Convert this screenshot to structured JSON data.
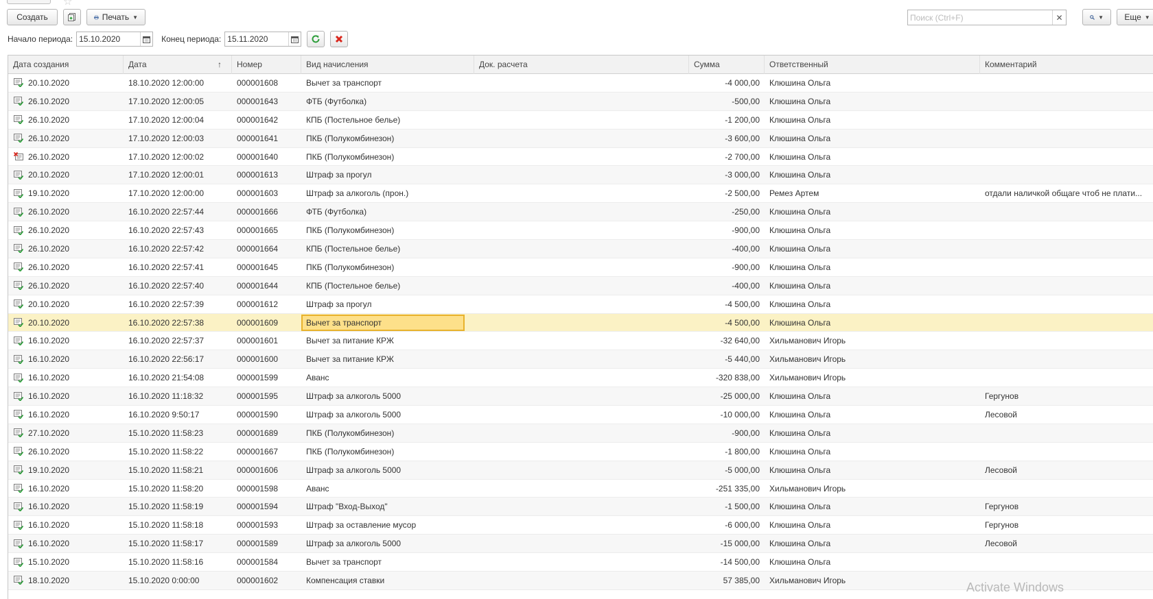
{
  "toolbar": {
    "create_label": "Создать",
    "print_label": "Печать",
    "more_label": "Еще"
  },
  "search": {
    "placeholder": "Поиск (Ctrl+F)"
  },
  "filter": {
    "start_label": "Начало периода:",
    "start_value": "15.10.2020",
    "end_label": "Конец периода:",
    "end_value": "15.11.2020"
  },
  "table": {
    "columns": [
      "Дата создания",
      "Дата",
      "Номер",
      "Вид начисления",
      "Док. расчета",
      "Сумма",
      "Ответственный",
      "Комментарий"
    ],
    "sorted_column_index": 1,
    "sort_direction": "asc",
    "selected_row_index": 13,
    "rows": [
      {
        "created": "20.10.2020",
        "date": "18.10.2020 12:00:00",
        "number": "000001608",
        "kind": "Вычет за транспорт",
        "doc": "",
        "sum": "-4 000,00",
        "responsible": "Клюшина Ольга",
        "comment": "",
        "status": "posted"
      },
      {
        "created": "26.10.2020",
        "date": "17.10.2020 12:00:05",
        "number": "000001643",
        "kind": "ФТБ (Футболка)",
        "doc": "",
        "sum": "-500,00",
        "responsible": "Клюшина Ольга",
        "comment": "",
        "status": "posted"
      },
      {
        "created": "26.10.2020",
        "date": "17.10.2020 12:00:04",
        "number": "000001642",
        "kind": "КПБ (Постельное белье)",
        "doc": "",
        "sum": "-1 200,00",
        "responsible": "Клюшина Ольга",
        "comment": "",
        "status": "posted"
      },
      {
        "created": "26.10.2020",
        "date": "17.10.2020 12:00:03",
        "number": "000001641",
        "kind": "ПКБ (Полукомбинезон)",
        "doc": "",
        "sum": "-3 600,00",
        "responsible": "Клюшина Ольга",
        "comment": "",
        "status": "posted"
      },
      {
        "created": "26.10.2020",
        "date": "17.10.2020 12:00:02",
        "number": "000001640",
        "kind": "ПКБ (Полукомбинезон)",
        "doc": "",
        "sum": "-2 700,00",
        "responsible": "Клюшина Ольга",
        "comment": "",
        "status": "deleted"
      },
      {
        "created": "20.10.2020",
        "date": "17.10.2020 12:00:01",
        "number": "000001613",
        "kind": "Штраф за прогул",
        "doc": "",
        "sum": "-3 000,00",
        "responsible": "Клюшина Ольга",
        "comment": "",
        "status": "posted"
      },
      {
        "created": "19.10.2020",
        "date": "17.10.2020 12:00:00",
        "number": "000001603",
        "kind": "Штраф за алкоголь (прон.)",
        "doc": "",
        "sum": "-2 500,00",
        "responsible": "Ремез Артем",
        "comment": "отдали наличкой общаге чтоб не плати...",
        "status": "posted"
      },
      {
        "created": "26.10.2020",
        "date": "16.10.2020 22:57:44",
        "number": "000001666",
        "kind": "ФТБ (Футболка)",
        "doc": "",
        "sum": "-250,00",
        "responsible": "Клюшина Ольга",
        "comment": "",
        "status": "posted"
      },
      {
        "created": "26.10.2020",
        "date": "16.10.2020 22:57:43",
        "number": "000001665",
        "kind": "ПКБ (Полукомбинезон)",
        "doc": "",
        "sum": "-900,00",
        "responsible": "Клюшина Ольга",
        "comment": "",
        "status": "posted"
      },
      {
        "created": "26.10.2020",
        "date": "16.10.2020 22:57:42",
        "number": "000001664",
        "kind": "КПБ (Постельное белье)",
        "doc": "",
        "sum": "-400,00",
        "responsible": "Клюшина Ольга",
        "comment": "",
        "status": "posted"
      },
      {
        "created": "26.10.2020",
        "date": "16.10.2020 22:57:41",
        "number": "000001645",
        "kind": "ПКБ (Полукомбинезон)",
        "doc": "",
        "sum": "-900,00",
        "responsible": "Клюшина Ольга",
        "comment": "",
        "status": "posted"
      },
      {
        "created": "26.10.2020",
        "date": "16.10.2020 22:57:40",
        "number": "000001644",
        "kind": "КПБ (Постельное белье)",
        "doc": "",
        "sum": "-400,00",
        "responsible": "Клюшина Ольга",
        "comment": "",
        "status": "posted"
      },
      {
        "created": "20.10.2020",
        "date": "16.10.2020 22:57:39",
        "number": "000001612",
        "kind": "Штраф за прогул",
        "doc": "",
        "sum": "-4 500,00",
        "responsible": "Клюшина Ольга",
        "comment": "",
        "status": "posted"
      },
      {
        "created": "20.10.2020",
        "date": "16.10.2020 22:57:38",
        "number": "000001609",
        "kind": "Вычет за транспорт",
        "doc": "",
        "sum": "-4 500,00",
        "responsible": "Клюшина Ольга",
        "comment": "",
        "status": "posted"
      },
      {
        "created": "16.10.2020",
        "date": "16.10.2020 22:57:37",
        "number": "000001601",
        "kind": "Вычет за питание КРЖ",
        "doc": "",
        "sum": "-32 640,00",
        "responsible": "Хильманович Игорь",
        "comment": "",
        "status": "posted"
      },
      {
        "created": "16.10.2020",
        "date": "16.10.2020 22:56:17",
        "number": "000001600",
        "kind": "Вычет за питание КРЖ",
        "doc": "",
        "sum": "-5 440,00",
        "responsible": "Хильманович Игорь",
        "comment": "",
        "status": "posted"
      },
      {
        "created": "16.10.2020",
        "date": "16.10.2020 21:54:08",
        "number": "000001599",
        "kind": "Аванс",
        "doc": "",
        "sum": "-320 838,00",
        "responsible": "Хильманович Игорь",
        "comment": "",
        "status": "posted"
      },
      {
        "created": "16.10.2020",
        "date": "16.10.2020 11:18:32",
        "number": "000001595",
        "kind": "Штраф за алкоголь 5000",
        "doc": "",
        "sum": "-25 000,00",
        "responsible": "Клюшина Ольга",
        "comment": "Гергунов",
        "status": "posted"
      },
      {
        "created": "16.10.2020",
        "date": "16.10.2020 9:50:17",
        "number": "000001590",
        "kind": "Штраф за алкоголь 5000",
        "doc": "",
        "sum": "-10 000,00",
        "responsible": "Клюшина Ольга",
        "comment": "Лесовой",
        "status": "posted"
      },
      {
        "created": "27.10.2020",
        "date": "15.10.2020 11:58:23",
        "number": "000001689",
        "kind": "ПКБ (Полукомбинезон)",
        "doc": "",
        "sum": "-900,00",
        "responsible": "Клюшина Ольга",
        "comment": "",
        "status": "posted"
      },
      {
        "created": "26.10.2020",
        "date": "15.10.2020 11:58:22",
        "number": "000001667",
        "kind": "ПКБ (Полукомбинезон)",
        "doc": "",
        "sum": "-1 800,00",
        "responsible": "Клюшина Ольга",
        "comment": "",
        "status": "posted"
      },
      {
        "created": "19.10.2020",
        "date": "15.10.2020 11:58:21",
        "number": "000001606",
        "kind": "Штраф за алкоголь 5000",
        "doc": "",
        "sum": "-5 000,00",
        "responsible": "Клюшина Ольга",
        "comment": "Лесовой",
        "status": "posted"
      },
      {
        "created": "16.10.2020",
        "date": "15.10.2020 11:58:20",
        "number": "000001598",
        "kind": "Аванс",
        "doc": "",
        "sum": "-251 335,00",
        "responsible": "Хильманович Игорь",
        "comment": "",
        "status": "posted"
      },
      {
        "created": "16.10.2020",
        "date": "15.10.2020 11:58:19",
        "number": "000001594",
        "kind": "Штраф \"Вход-Выход\"",
        "doc": "",
        "sum": "-1 500,00",
        "responsible": "Клюшина Ольга",
        "comment": "Гергунов",
        "status": "posted"
      },
      {
        "created": "16.10.2020",
        "date": "15.10.2020 11:58:18",
        "number": "000001593",
        "kind": "Штраф за оставление мусор",
        "doc": "",
        "sum": "-6 000,00",
        "responsible": "Клюшина Ольга",
        "comment": "Гергунов",
        "status": "posted"
      },
      {
        "created": "16.10.2020",
        "date": "15.10.2020 11:58:17",
        "number": "000001589",
        "kind": "Штраф за алкоголь 5000",
        "doc": "",
        "sum": "-15 000,00",
        "responsible": "Клюшина Ольга",
        "comment": "Лесовой",
        "status": "posted"
      },
      {
        "created": "15.10.2020",
        "date": "15.10.2020 11:58:16",
        "number": "000001584",
        "kind": "Вычет за транспорт",
        "doc": "",
        "sum": "-14 500,00",
        "responsible": "Клюшина Ольга",
        "comment": "",
        "status": "posted"
      },
      {
        "created": "18.10.2020",
        "date": "15.10.2020 0:00:00",
        "number": "000001602",
        "kind": "Компенсация ставки",
        "doc": "",
        "sum": "57 385,00",
        "responsible": "Хильманович Игорь",
        "comment": "",
        "status": "posted"
      }
    ]
  },
  "watermark": "Activate Windows",
  "colors": {
    "selected_row": "#fbf2c5",
    "focused_cell": "#fde08a",
    "focused_border": "#e8b22c",
    "refresh_icon": "#2e9e3b",
    "clear_icon": "#d9261c"
  }
}
